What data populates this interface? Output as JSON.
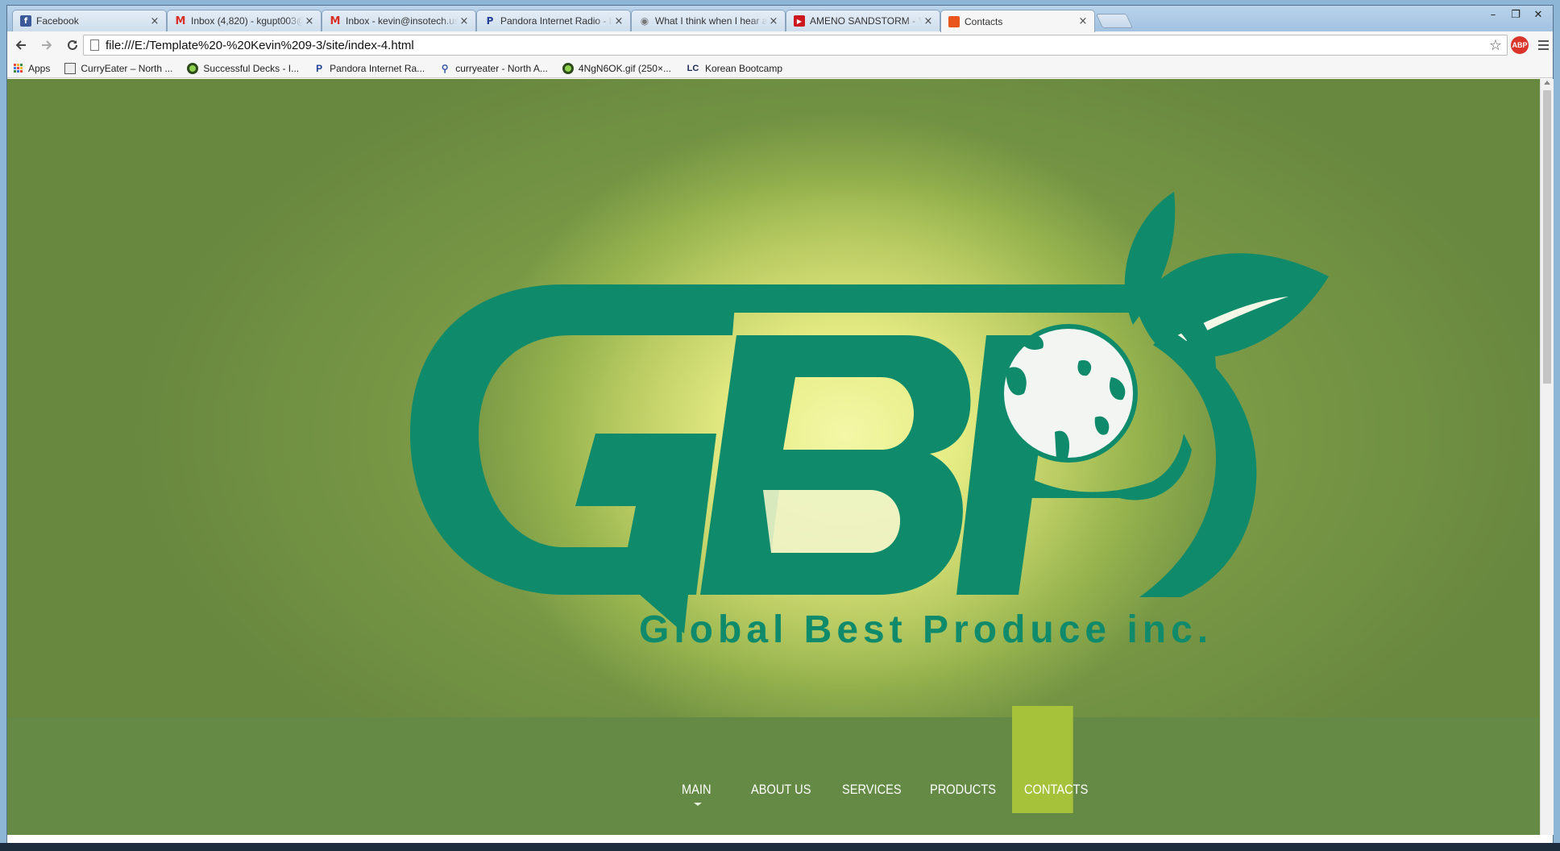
{
  "browser": {
    "tabs": [
      {
        "title": "Facebook",
        "icon": "facebook-icon",
        "color": "#3b5998"
      },
      {
        "title": "Inbox (4,820) - kgupt003@",
        "icon": "gmail-icon",
        "color": "#d93025"
      },
      {
        "title": "Inbox - kevin@insotech.us",
        "icon": "gmail-icon",
        "color": "#d93025"
      },
      {
        "title": "Pandora Internet Radio - L",
        "icon": "pandora-icon",
        "color": "#224099"
      },
      {
        "title": "What I think when I hear a",
        "icon": "reddit-icon",
        "color": "#777777"
      },
      {
        "title": "AMENO SANDSTORM - Y",
        "icon": "youtube-icon",
        "color": "#cc181e"
      },
      {
        "title": "Contacts",
        "icon": "site-favicon",
        "color": "#e8541b"
      }
    ],
    "address": "file:///E:/Template%20-%20Kevin%209-3/site/index-4.html",
    "bookmarks": [
      {
        "label": "Apps",
        "icon": "apps-icon"
      },
      {
        "label": "CurryEater – North ...",
        "icon": "page-icon"
      },
      {
        "label": "Successful Decks - I...",
        "icon": "green-circle-icon"
      },
      {
        "label": "Pandora Internet Ra...",
        "icon": "pandora-icon"
      },
      {
        "label": "curryeater - North A...",
        "icon": "link-icon"
      },
      {
        "label": "4NgN6OK.gif (250×...",
        "icon": "green-circle-icon"
      },
      {
        "label": "Korean Bootcamp",
        "icon": "lc-icon"
      }
    ],
    "extension": "ABP"
  },
  "site": {
    "logo_text": "GBP",
    "company_name": "Global Best Produce inc.",
    "nav": [
      {
        "label": "MAIN"
      },
      {
        "label": "ABOUT US"
      },
      {
        "label": "SERVICES"
      },
      {
        "label": "PRODUCTS"
      },
      {
        "label": "CONTACTS"
      }
    ],
    "active_nav": "CONTACTS"
  },
  "colors": {
    "logo_green": "#0f8b6c",
    "background_green": "#79984a",
    "nav_band": "#658a45",
    "active_nav": "#a6c23a"
  }
}
